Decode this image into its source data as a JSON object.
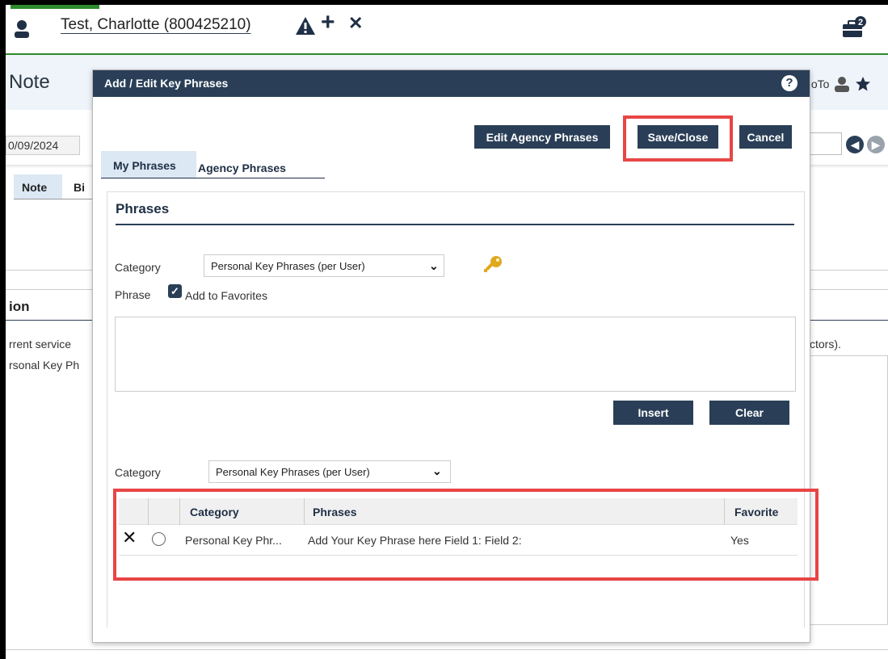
{
  "app": {
    "patient_name": "Test, Charlotte (800425210)",
    "page_title": "Note",
    "goto_label": "GoTo",
    "date_value": "0/09/2024",
    "tab_note": "Note",
    "tab_bi": "Bi",
    "section_title": "ion",
    "bg_text_1": "rrent service",
    "bg_text_2": "rsonal Key Ph",
    "bg_text_right": "ctors).",
    "notification_count": "2"
  },
  "modal": {
    "title": "Add / Edit Key Phrases",
    "help_label": "?",
    "buttons": {
      "edit_agency": "Edit Agency Phrases",
      "save_close": "Save/Close",
      "cancel": "Cancel",
      "insert": "Insert",
      "clear": "Clear"
    },
    "tabs": [
      "My Phrases",
      "Agency Phrases"
    ],
    "section_title": "Phrases",
    "category_label": "Category",
    "category_value": "Personal Key Phrases (per User)",
    "phrase_label": "Phrase",
    "add_to_favorites_label": "Add to Favorites",
    "add_to_favorites_checked": true,
    "filter_category_label": "Category",
    "filter_category_value": "Personal Key Phrases (per User)",
    "grid": {
      "columns": [
        "Category",
        "Phrases",
        "Favorite"
      ],
      "rows": [
        {
          "category": "Personal Key Phr...",
          "phrases": "Add Your Key Phrase here Field 1: Field 2:",
          "favorite": "Yes"
        }
      ]
    }
  },
  "colors": {
    "primary": "#2a3f57",
    "highlight": "#e84545",
    "green": "#2e8b2e"
  }
}
